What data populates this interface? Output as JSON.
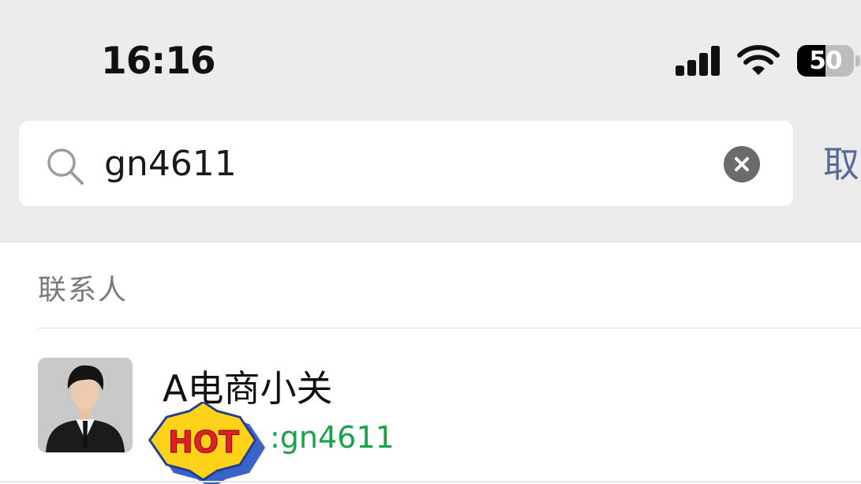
{
  "status_bar": {
    "time": "16:16",
    "battery_text": "50",
    "battery_level": 0.5
  },
  "search": {
    "query": "gn4611",
    "placeholder": "",
    "cancel_label": "取"
  },
  "results": {
    "section_title": "联系人",
    "contacts": [
      {
        "name": "A电商小关",
        "id_visible": ":gn4611",
        "badge": "HOT"
      }
    ]
  },
  "colors": {
    "background_top": "#ececec",
    "accent_cancel": "#596a97",
    "match_green": "#1aa34a",
    "badge_yellow": "#ffd21a",
    "badge_red": "#e31f26",
    "badge_blue": "#3a63c9"
  },
  "icons": {
    "search": "search-icon",
    "clear": "clear-icon",
    "signal": "signal-icon",
    "wifi": "wifi-icon",
    "battery": "battery-icon",
    "badge": "hot-badge-icon"
  }
}
